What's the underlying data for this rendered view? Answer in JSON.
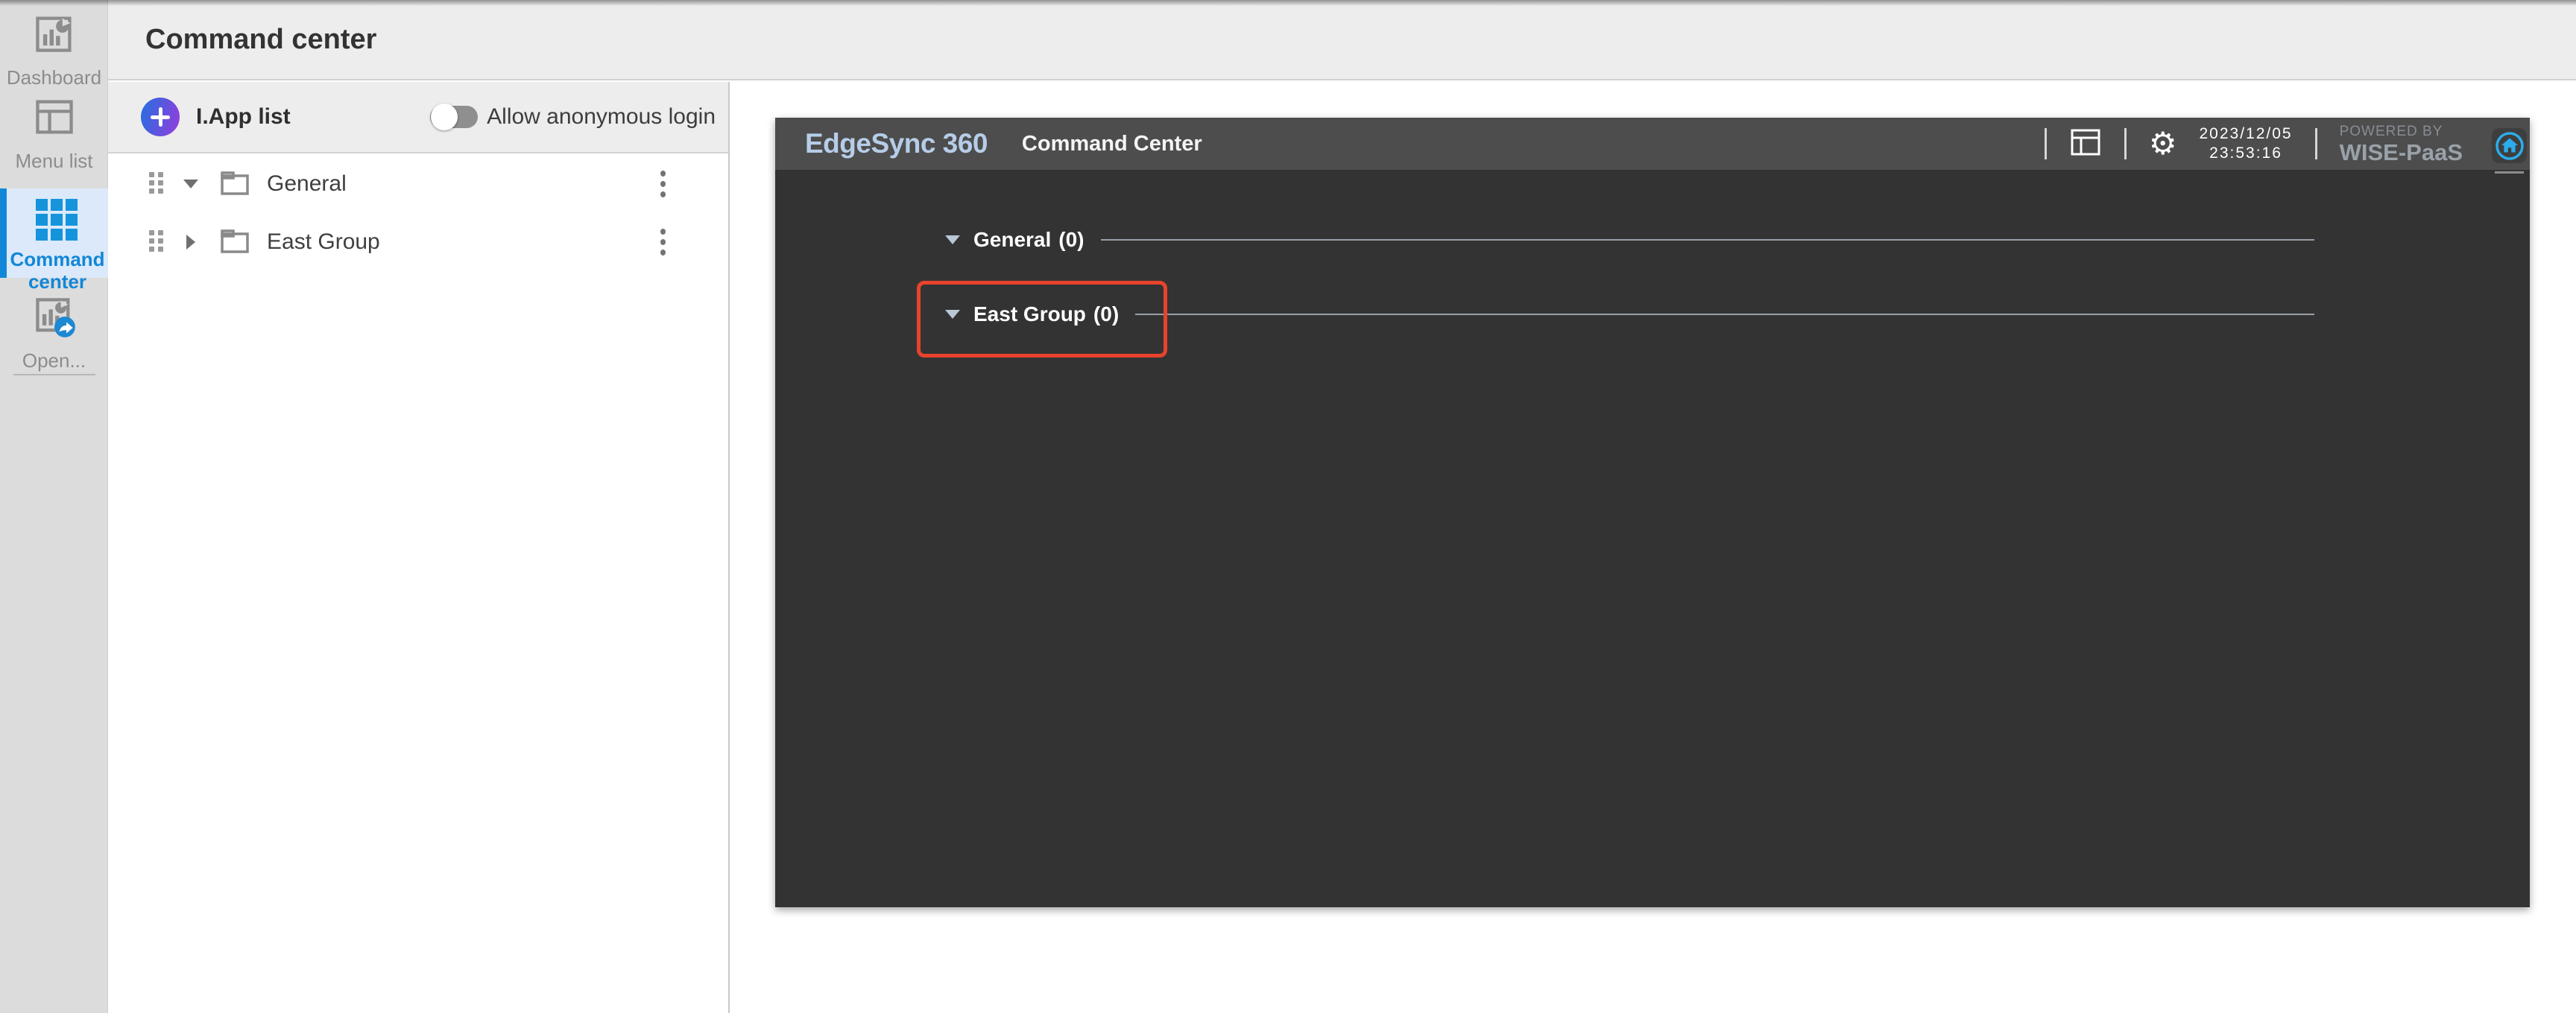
{
  "sidebar": {
    "items": [
      {
        "label": "Dashboard",
        "icon": "dashboard-chart-icon",
        "active": false
      },
      {
        "label": "Menu list",
        "icon": "menu-layout-icon",
        "active": false
      },
      {
        "label": "Command center",
        "icon": "grid-icon",
        "active": true
      },
      {
        "label": "Open...",
        "icon": "open-external-chart-icon",
        "active": false
      }
    ]
  },
  "header": {
    "title": "Command center"
  },
  "tree_panel": {
    "title": "I.App list",
    "add_button": "add",
    "toggle_label": "Allow anonymous login",
    "toggle_on": false,
    "items": [
      {
        "name": "General",
        "expanded": true
      },
      {
        "name": "East Group",
        "expanded": false
      }
    ]
  },
  "panel": {
    "brand": "EdgeSync 360",
    "title": "Command Center",
    "datetime": {
      "date": "2023/12/05",
      "time": "23:53:16"
    },
    "powered_by": {
      "line1": "POWERED BY",
      "line2": "WISE-PaaS"
    },
    "groups": [
      {
        "name": "General",
        "count": "(0)",
        "expanded": true,
        "highlighted": false
      },
      {
        "name": "East Group",
        "count": "(0)",
        "expanded": true,
        "highlighted": true
      }
    ],
    "colors": {
      "highlight_border": "#e8432c",
      "accent_blue": "#2bacec",
      "brand_text": "#b6cde8",
      "panel_header_bg": "#4d4d4d",
      "panel_body_bg": "#333333",
      "sidebar_active_blue": "#1287d8"
    }
  }
}
